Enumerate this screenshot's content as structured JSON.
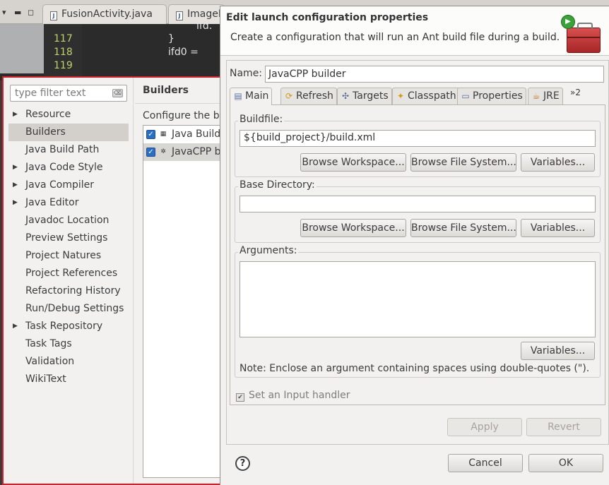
{
  "editor": {
    "tabs": [
      {
        "label": "FusionActivity.java"
      },
      {
        "label": "ImageF"
      }
    ],
    "code_lines": [
      {
        "num": "",
        "text": "ifd."
      },
      {
        "num": "117",
        "text": "}"
      },
      {
        "num": "118",
        "text": "ifd0 = "
      },
      {
        "num": "119",
        "text": ""
      }
    ]
  },
  "properties": {
    "filter_placeholder": "type filter text",
    "tree": [
      {
        "label": "Resource",
        "expandable": true
      },
      {
        "label": "Builders",
        "selected": true
      },
      {
        "label": "Java Build Path"
      },
      {
        "label": "Java Code Style",
        "expandable": true
      },
      {
        "label": "Java Compiler",
        "expandable": true
      },
      {
        "label": "Java Editor",
        "expandable": true
      },
      {
        "label": "Javadoc Location"
      },
      {
        "label": "Preview Settings"
      },
      {
        "label": "Project Natures"
      },
      {
        "label": "Project References"
      },
      {
        "label": "Refactoring History"
      },
      {
        "label": "Run/Debug Settings"
      },
      {
        "label": "Task Repository",
        "expandable": true
      },
      {
        "label": "Task Tags"
      },
      {
        "label": "Validation"
      },
      {
        "label": "WikiText"
      }
    ],
    "page_title": "Builders",
    "page_desc": "Configure the bu",
    "builders": [
      {
        "label": "Java Build",
        "checked": true,
        "icon": "binary-icon"
      },
      {
        "label": "JavaCPP b",
        "checked": true,
        "icon": "ant-icon",
        "selected": true
      }
    ]
  },
  "dialog": {
    "title": "Edit launch configuration properties",
    "description": "Create a configuration that will run an Ant build file during a build.",
    "name_label": "Name:",
    "name_value": "JavaCPP builder",
    "tabs": [
      {
        "label": "Main",
        "icon": "main-icon",
        "active": true
      },
      {
        "label": "Refresh",
        "icon": "refresh-icon"
      },
      {
        "label": "Targets",
        "icon": "targets-icon"
      },
      {
        "label": "Classpath",
        "icon": "classpath-icon"
      },
      {
        "label": "Properties",
        "icon": "properties-icon"
      },
      {
        "label": "JRE",
        "icon": "jre-icon"
      }
    ],
    "tabs_overflow": "»2",
    "buildfile": {
      "label": "Buildfile:",
      "value": "${build_project}/build.xml",
      "browse_workspace": "Browse Workspace...",
      "browse_fs": "Browse File System...",
      "variables": "Variables..."
    },
    "base_dir": {
      "label": "Base Directory:",
      "value": "",
      "browse_workspace": "Browse Workspace...",
      "browse_fs": "Browse File System...",
      "variables": "Variables..."
    },
    "arguments": {
      "label": "Arguments:",
      "value": "",
      "variables": "Variables...",
      "note": "Note: Enclose an argument containing spaces using double-quotes (\")."
    },
    "input_handler_label": "Set an Input handler",
    "apply": "Apply",
    "revert": "Revert",
    "cancel": "Cancel",
    "ok": "OK",
    "help_glyph": "?"
  }
}
